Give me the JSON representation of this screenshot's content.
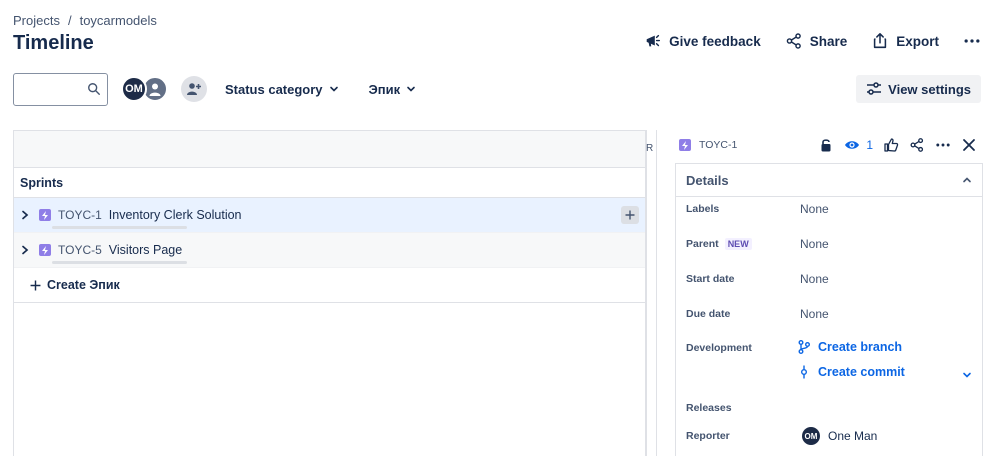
{
  "breadcrumb": {
    "root": "Projects",
    "sep": "/",
    "project": "toycarmodels"
  },
  "page": {
    "title": "Timeline"
  },
  "actions": {
    "feedback": "Give feedback",
    "share": "Share",
    "export": "Export"
  },
  "toolbar": {
    "search_placeholder": "",
    "avatar_initials": "OM",
    "status_filter": "Status category",
    "epic_filter": "Эпик",
    "view_settings": "View settings"
  },
  "timeline": {
    "sprints_label": "Sprints",
    "r_marker": "R",
    "issues": [
      {
        "key": "TOYC-1",
        "title": "Inventory Clerk Solution"
      },
      {
        "key": "TOYC-5",
        "title": "Visitors Page"
      }
    ],
    "create_label": "Create Эпик"
  },
  "panel": {
    "issue_key": "TOYC-1",
    "watch_count": "1",
    "details_title": "Details",
    "fields": {
      "labels": {
        "label": "Labels",
        "value": "None"
      },
      "parent": {
        "label": "Parent",
        "badge": "NEW",
        "value": "None"
      },
      "start": {
        "label": "Start date",
        "value": "None"
      },
      "due": {
        "label": "Due date",
        "value": "None"
      },
      "development": {
        "label": "Development",
        "branch": "Create branch",
        "commit": "Create commit"
      },
      "releases": {
        "label": "Releases"
      },
      "reporter": {
        "label": "Reporter",
        "initials": "OM",
        "name": "One Man"
      }
    }
  },
  "colors": {
    "accent": "#0c66e4",
    "epic": "#8f7ee7",
    "selected_row": "#e9f2ff"
  }
}
